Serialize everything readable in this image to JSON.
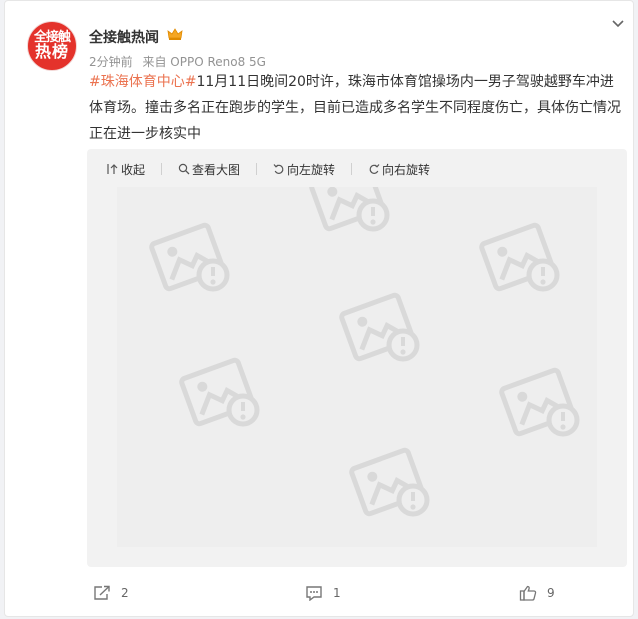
{
  "author": {
    "avatar_line1": "全接触",
    "avatar_line2": "热榜",
    "name": "全接触热闻",
    "badge_icon": "crown-icon"
  },
  "meta": {
    "time": "2分钟前",
    "source": "来自 OPPO Reno8 5G"
  },
  "post": {
    "hashtag": "#珠海体育中心#",
    "body": "11月11日晚间20时许，珠海市体育馆操场内一男子驾驶越野车冲进体育场。撞击多名正在跑步的学生，目前已造成多名学生不同程度伤亡，具体伤亡情况正在进一步核实中"
  },
  "media_toolbar": {
    "collapse": "收起",
    "view_large": "查看大图",
    "rotate_left": "向左旋转",
    "rotate_right": "向右旋转"
  },
  "footer": {
    "repost_count": "2",
    "comment_count": "1",
    "like_count": "9"
  },
  "colors": {
    "hashtag": "#eb7350",
    "avatar_bg": "#e4322b"
  }
}
